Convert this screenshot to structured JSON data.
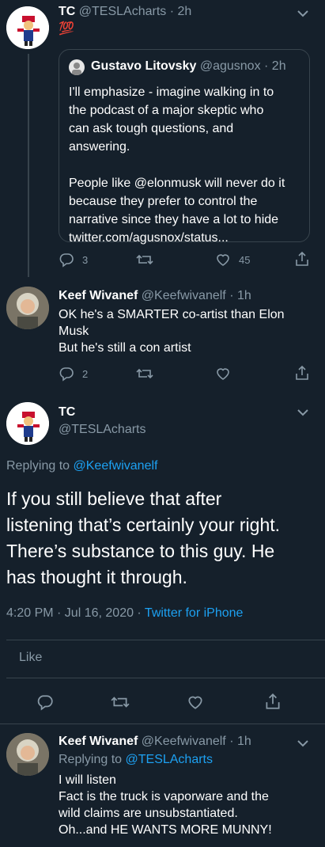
{
  "tweet1": {
    "name": "TC",
    "handle": "@TESLAcharts",
    "time": "· 2h",
    "text": "💯",
    "quote": {
      "name": "Gustavo Litovsky",
      "handle": "@agusnox",
      "time": "· 2h",
      "text_lines": [
        "I'll emphasize - imagine walking in to",
        "the podcast of a major skeptic who",
        "can ask tough questions, and",
        "answering.",
        "",
        "People like @elonmusk will never do it",
        "because they prefer to control the",
        "narrative since they have a lot to hide",
        "twitter.com/agusnox/status..."
      ]
    },
    "reply_count": "3",
    "like_count": "45"
  },
  "tweet2": {
    "name": "Keef Wivanef",
    "handle": "@Keefwivanelf",
    "time": "· 1h",
    "text_lines": [
      "OK he's a SMARTER co-artist than Elon",
      "Musk",
      "But he's still a con artist"
    ],
    "reply_count": "2"
  },
  "main": {
    "name": "TC",
    "handle": "@TESLAcharts",
    "replying_prefix": "Replying to",
    "replying_to": "@Keefwivanelf",
    "text_lines": [
      "If you still believe that after",
      "listening that’s certainly your right.",
      "There’s substance to this guy. He",
      "has thought it through."
    ],
    "timestamp": "4:20 PM · Jul 16, 2020 ·",
    "source": "Twitter for iPhone",
    "like_label": "Like"
  },
  "tweet4": {
    "name": "Keef Wivanef",
    "handle": "@Keefwivanelf",
    "time": "· 1h",
    "replying_prefix": "Replying to",
    "replying_to": "@TESLAcharts",
    "text_lines": [
      "I will listen",
      "Fact is the truck is vaporware and the",
      "wild claims are unsubstantiated.",
      "Oh...and HE WANTS MORE MUNNY!"
    ]
  },
  "colors": {
    "background": "#15202b",
    "muted": "#8899a6",
    "link": "#1da1f2",
    "divider": "#38444d"
  },
  "icons": [
    "chevron-down-icon",
    "reply-icon",
    "retweet-icon",
    "like-icon",
    "share-icon",
    "verified-avatar"
  ]
}
